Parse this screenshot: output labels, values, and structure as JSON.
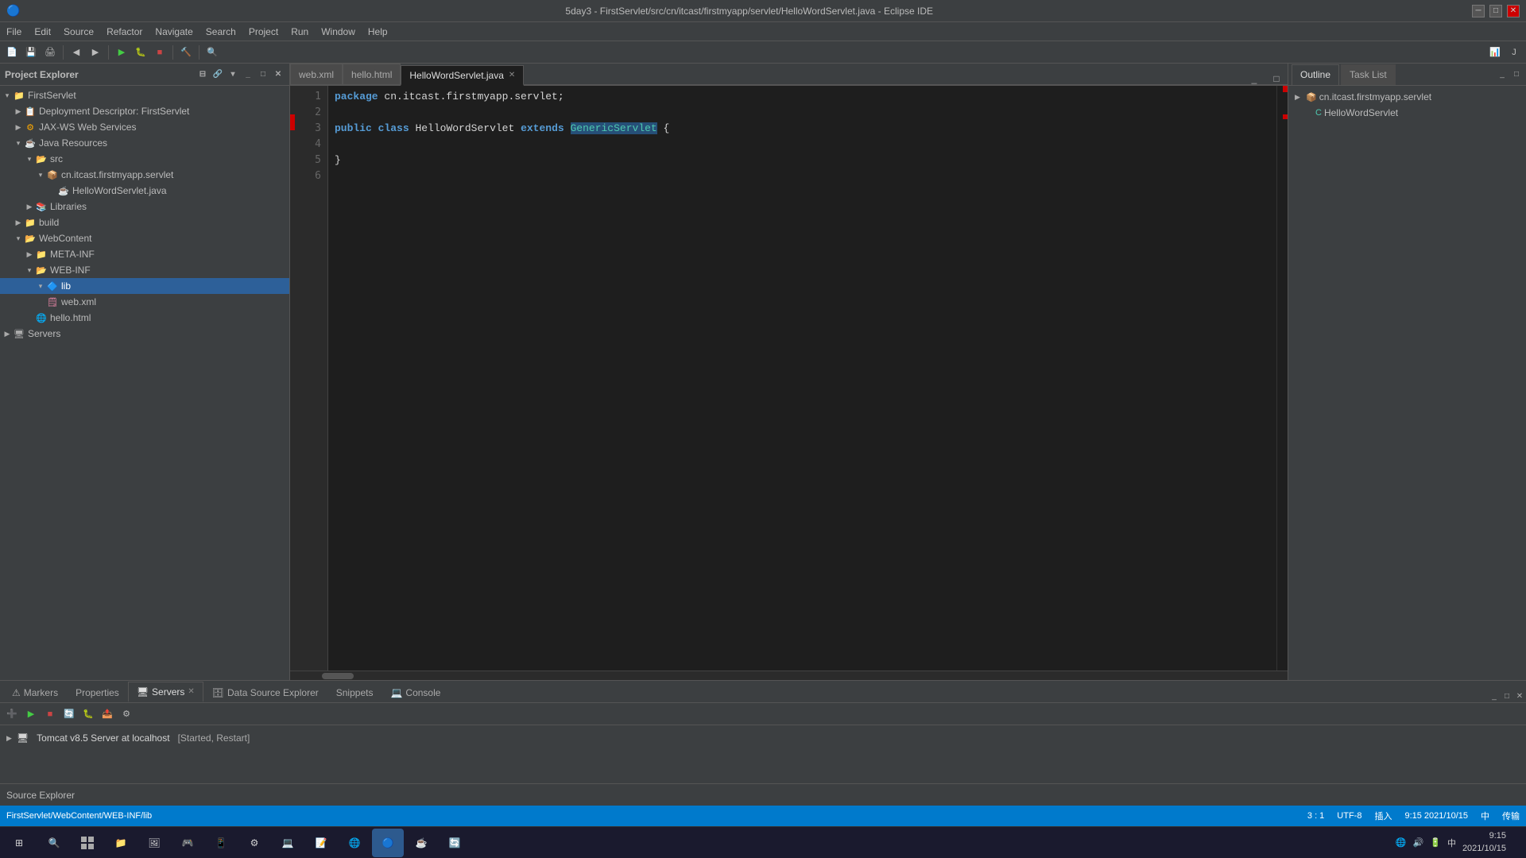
{
  "titleBar": {
    "title": "5day3 - FirstServlet/src/cn/itcast/firstmyapp/servlet/HelloWordServlet.java - Eclipse IDE",
    "min": "─",
    "max": "□",
    "close": "✕"
  },
  "menuBar": {
    "items": [
      "File",
      "Edit",
      "Source",
      "Refactor",
      "Navigate",
      "Search",
      "Project",
      "Run",
      "Window",
      "Help"
    ]
  },
  "leftPanel": {
    "title": "Project Explorer",
    "tree": [
      {
        "label": "FirstServlet",
        "level": 0,
        "type": "project",
        "expanded": true
      },
      {
        "label": "Deployment Descriptor: FirstServlet",
        "level": 1,
        "type": "dd",
        "expanded": false
      },
      {
        "label": "JAX-WS Web Services",
        "level": 1,
        "type": "ws",
        "expanded": false
      },
      {
        "label": "Java Resources",
        "level": 1,
        "type": "java",
        "expanded": true
      },
      {
        "label": "src",
        "level": 2,
        "type": "folder",
        "expanded": true
      },
      {
        "label": "cn.itcast.firstmyapp.servlet",
        "level": 3,
        "type": "package",
        "expanded": true
      },
      {
        "label": "HelloWordServlet.java",
        "level": 4,
        "type": "java-file",
        "selected": false
      },
      {
        "label": "Libraries",
        "level": 2,
        "type": "libraries",
        "expanded": false
      },
      {
        "label": "build",
        "level": 1,
        "type": "folder",
        "expanded": false
      },
      {
        "label": "WebContent",
        "level": 1,
        "type": "folder",
        "expanded": true
      },
      {
        "label": "META-INF",
        "level": 2,
        "type": "folder",
        "expanded": false
      },
      {
        "label": "WEB-INF",
        "level": 2,
        "type": "folder",
        "expanded": true
      },
      {
        "label": "lib",
        "level": 3,
        "type": "folder",
        "selected": true
      },
      {
        "label": "web.xml",
        "level": 3,
        "type": "xml-file",
        "selected": false
      },
      {
        "label": "hello.html",
        "level": 2,
        "type": "html-file",
        "selected": false
      },
      {
        "label": "Servers",
        "level": 0,
        "type": "servers",
        "expanded": false
      }
    ]
  },
  "tabs": [
    {
      "label": "web.xml",
      "active": false,
      "closable": false
    },
    {
      "label": "hello.html",
      "active": false,
      "closable": false
    },
    {
      "label": "HelloWordServlet.java",
      "active": true,
      "closable": true
    }
  ],
  "editor": {
    "lines": [
      {
        "num": 1,
        "content_parts": [
          {
            "text": "package",
            "type": "kw"
          },
          {
            "text": " cn.itcast.firstmyapp.servlet;",
            "type": "normal"
          }
        ]
      },
      {
        "num": 2,
        "content_parts": []
      },
      {
        "num": 3,
        "content_parts": [
          {
            "text": "public",
            "type": "kw"
          },
          {
            "text": " ",
            "type": "normal"
          },
          {
            "text": "class",
            "type": "kw"
          },
          {
            "text": " HelloWordServlet ",
            "type": "normal"
          },
          {
            "text": "extends",
            "type": "kw"
          },
          {
            "text": " GenericServlet",
            "type": "selected"
          },
          {
            "text": "{",
            "type": "normal"
          }
        ],
        "hasMarker": true
      },
      {
        "num": 4,
        "content_parts": []
      },
      {
        "num": 5,
        "content_parts": [
          {
            "text": "}",
            "type": "normal"
          }
        ]
      },
      {
        "num": 6,
        "content_parts": []
      }
    ]
  },
  "rightPanel": {
    "tabs": [
      "Outline",
      "Task List"
    ],
    "activeTab": "Outline",
    "tree": [
      {
        "label": "cn.itcast.firstmyapp.servlet",
        "level": 0,
        "type": "package"
      },
      {
        "label": "HelloWordServlet",
        "level": 1,
        "type": "class"
      }
    ]
  },
  "bottomPanel": {
    "tabs": [
      "Markers",
      "Properties",
      "Servers",
      "Data Source Explorer",
      "Snippets",
      "Console"
    ],
    "activeTab": "Servers",
    "servers": [
      {
        "label": "Tomcat v8.5 Server at localhost",
        "status": "[Started, Restart]"
      }
    ]
  },
  "statusBar": {
    "path": "FirstServlet/WebContent/WEB-INF/lib",
    "time": "9:15",
    "date": "2021/10/15",
    "encoding": "UTF-8",
    "lineCol": "3 : 1",
    "insertMode": "插入传输"
  },
  "sourceExplorer": {
    "label": "Source Explorer"
  },
  "taskbar": {
    "items": [
      "⊞",
      "🔍",
      "🌐",
      "📁",
      "🖼",
      "🎮",
      "📱",
      "⚙",
      "💻",
      "📝",
      "🌏"
    ],
    "time": "9:15",
    "date": "2021/10/15"
  }
}
